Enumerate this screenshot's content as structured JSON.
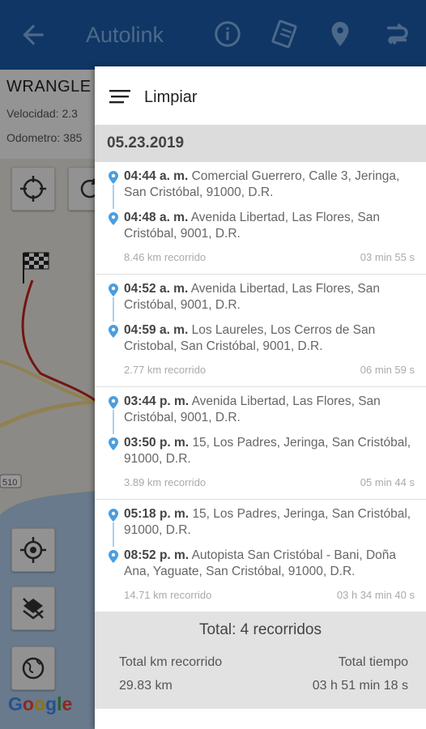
{
  "app": {
    "title": "Autolink"
  },
  "vehicle": {
    "name": "WRANGLE",
    "speed": "Velocidad: 2.3",
    "odometer": "Odometro: 385"
  },
  "map": {
    "road_shield": "510",
    "google": "Google"
  },
  "drawer": {
    "clear_label": "Limpiar",
    "date": "05.23.2019",
    "trips": [
      {
        "start_time": "04:44 a. m.",
        "start_addr": "Comercial Guerrero, Calle 3, Jeringa, San Cristóbal, 91000, D.R.",
        "end_time": "04:48 a. m.",
        "end_addr": "Avenida Libertad, Las Flores, San Cristóbal, 9001, D.R.",
        "distance": "8.46 km recorrido",
        "duration": "03 min 55 s"
      },
      {
        "start_time": "04:52 a. m.",
        "start_addr": "Avenida Libertad, Las Flores, San Cristóbal, 9001, D.R.",
        "end_time": "04:59 a. m.",
        "end_addr": "Los Laureles, Los Cerros de San Cristobal, San Cristóbal, 9001, D.R.",
        "distance": "2.77 km recorrido",
        "duration": "06 min 59 s"
      },
      {
        "start_time": "03:44 p. m.",
        "start_addr": "Avenida Libertad, Las Flores, San Cristóbal, 9001, D.R.",
        "end_time": "03:50 p. m.",
        "end_addr": "15, Los Padres, Jeringa, San Cristóbal, 91000, D.R.",
        "distance": "3.89 km recorrido",
        "duration": "05 min 44 s"
      },
      {
        "start_time": "05:18 p. m.",
        "start_addr": "15, Los Padres, Jeringa, San Cristóbal, 91000, D.R.",
        "end_time": "08:52 p. m.",
        "end_addr": "Autopista San Cristóbal - Bani, Doña Ana, Yaguate, San Cristóbal, 91000, D.R.",
        "distance": "14.71 km recorrido",
        "duration": "03 h 34 min 40 s"
      }
    ],
    "totals": {
      "header": "Total: 4 recorridos",
      "km_label": "Total km recorrido",
      "km_value": "29.83 km",
      "time_label": "Total tiempo",
      "time_value": "03 h 51 min 18 s"
    }
  },
  "colors": {
    "appbar": "#1c5aa8",
    "pin": "#4a9ee0"
  }
}
